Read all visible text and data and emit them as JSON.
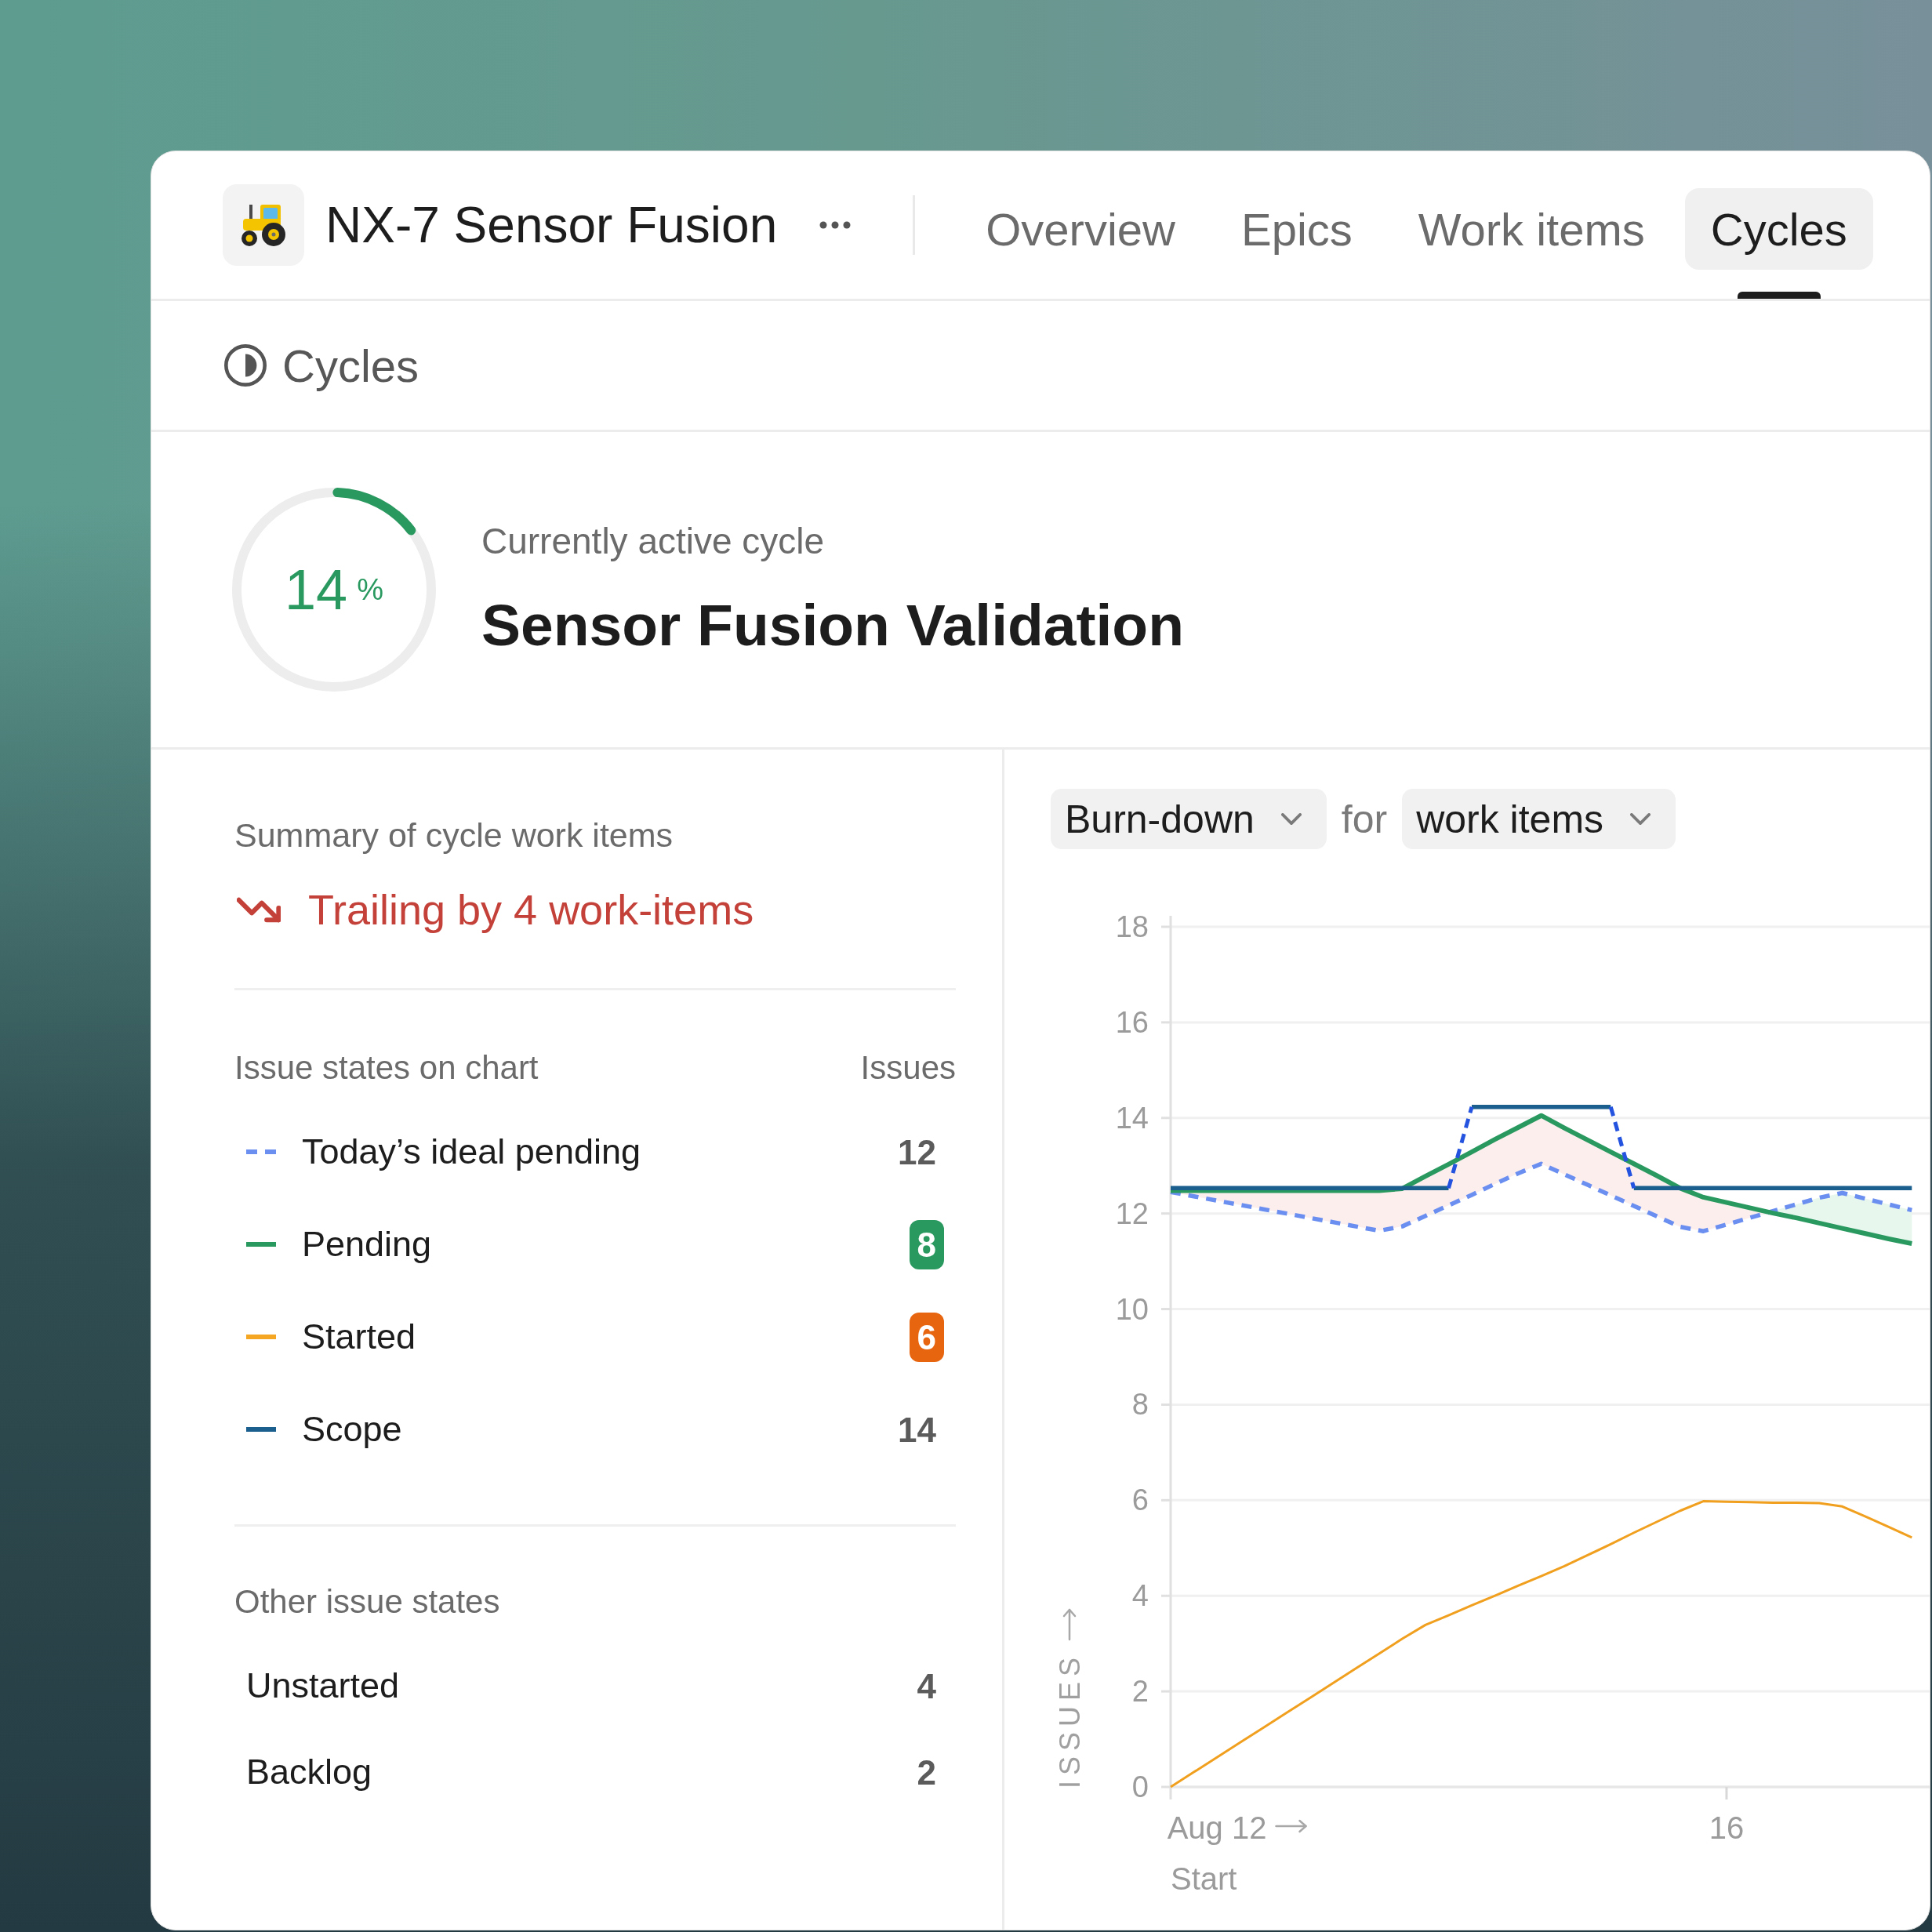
{
  "project": {
    "name": "NX-7 Sensor Fusion"
  },
  "tabs": [
    {
      "label": "Overview",
      "selected": false
    },
    {
      "label": "Epics",
      "selected": false
    },
    {
      "label": "Work items",
      "selected": false
    },
    {
      "label": "Cycles",
      "selected": true
    }
  ],
  "page": {
    "title": "Cycles"
  },
  "active_cycle": {
    "progress": {
      "level": 0.14,
      "value": "14",
      "unit": "%"
    },
    "caption": "Currently active cycle",
    "name": "Sensor Fusion Validation"
  },
  "summary": {
    "title": "Summary of cycle work items",
    "status": "Trailing by 4 work-items",
    "chart_states": {
      "heading": "Issue states on chart",
      "count_heading": "Issues",
      "items": [
        {
          "label": "Today’s ideal pending",
          "count": "12",
          "color": "#6b8ff0",
          "dashed": true
        },
        {
          "label": "Pending",
          "count": "8",
          "color": "#2a9960",
          "dashed": false,
          "badge": {
            "color": "#2a9960"
          }
        },
        {
          "label": "Started",
          "count": "6",
          "color": "#f5a623",
          "dashed": false,
          "badge": {
            "color": "#e8650f"
          }
        },
        {
          "label": "Scope",
          "count": "14",
          "color": "#1b5f8f",
          "dashed": false
        }
      ]
    },
    "other_states": {
      "heading": "Other issue states",
      "items": [
        {
          "label": "Unstarted",
          "count": "4"
        },
        {
          "label": "Backlog",
          "count": "2"
        }
      ]
    }
  },
  "chart_panel": {
    "chart_type": "Burn-down",
    "connector": "for",
    "subject": "work items",
    "chart_data": {
      "type": "line",
      "ylabel": "ISSUES",
      "grid": true,
      "categories": [
        null,
        null,
        "Aug 12",
        null,
        null,
        null,
        null,
        null,
        null,
        null,
        null,
        null,
        null,
        null,
        null,
        null,
        null,
        null,
        null,
        null,
        null,
        null,
        null,
        null,
        "16",
        null,
        null,
        null,
        null,
        null,
        null,
        null,
        null
      ],
      "series": [
        {
          "color": "#6b8ff0",
          "line_style": "dashed",
          "values": [
            12.45,
            12.36,
            12.27,
            12.18,
            12.09,
            12.0,
            11.91,
            11.82,
            11.73,
            11.64,
            11.73,
            11.95,
            12.17,
            12.39,
            12.62,
            12.84,
            13.04,
            12.82,
            12.6,
            12.38,
            12.16,
            11.94,
            11.72,
            11.63,
            11.77,
            11.91,
            12.05,
            12.19,
            12.33,
            12.43,
            12.31,
            12.19,
            12.07
          ]
        },
        {
          "color": "#2a9960",
          "line_style": "solid",
          "values": [
            12.48,
            12.48,
            12.48,
            12.48,
            12.48,
            12.48,
            12.48,
            12.48,
            12.48,
            12.48,
            12.52,
            12.78,
            13.03,
            13.29,
            13.55,
            13.8,
            14.05,
            13.79,
            13.54,
            13.29,
            13.04,
            12.79,
            12.53,
            12.34,
            12.23,
            12.12,
            12.01,
            11.91,
            11.8,
            11.69,
            11.58,
            11.47,
            11.37
          ]
        },
        {
          "color": "#f0a01e",
          "line_style": "solid",
          "values": [
            0,
            0.31,
            0.62,
            0.93,
            1.24,
            1.55,
            1.86,
            2.17,
            2.48,
            2.79,
            3.1,
            3.39,
            3.59,
            3.8,
            4.0,
            4.21,
            4.41,
            4.62,
            4.85,
            5.08,
            5.32,
            5.55,
            5.78,
            5.98,
            5.97,
            5.96,
            5.95,
            5.95,
            5.94,
            5.87,
            5.66,
            5.44,
            5.22
          ]
        },
        {
          "color": "#1b5f8f",
          "line_style": "solid",
          "values": [
            12.53,
            12.53,
            12.53,
            12.53,
            12.53,
            12.53,
            12.53,
            12.53,
            12.53,
            12.53,
            12.53,
            12.53,
            12.53,
            14.23,
            14.23,
            14.23,
            14.23,
            14.23,
            14.23,
            14.23,
            12.53,
            12.53,
            12.53,
            12.53,
            12.53,
            12.53,
            12.53,
            12.53,
            12.53,
            12.53,
            12.53,
            12.53,
            12.53
          ]
        }
      ],
      "ylim": [
        0,
        18
      ],
      "yticks": [
        0,
        2,
        4,
        6,
        8,
        10,
        12,
        14,
        16,
        18
      ],
      "annotations": [
        "Start"
      ]
    }
  }
}
